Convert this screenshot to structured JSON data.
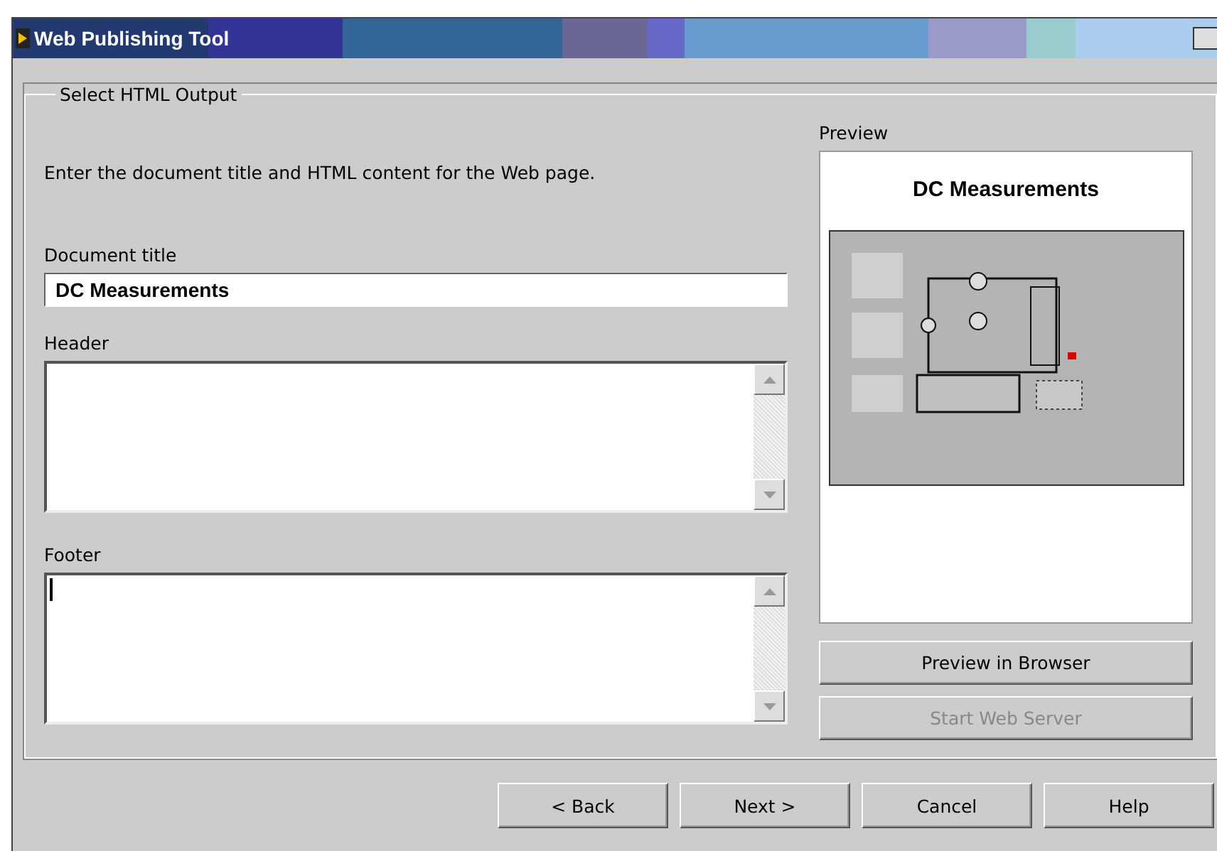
{
  "window": {
    "title": "Web Publishing Tool"
  },
  "group": {
    "label": "Select HTML Output",
    "instructions": "Enter the document title and HTML content for the Web page."
  },
  "fields": [
    {
      "kind": "single",
      "label": "Document title",
      "value": "DC Measurements"
    },
    {
      "kind": "multiline",
      "label": "Header",
      "focused": false
    },
    {
      "kind": "multiline",
      "label": "Footer",
      "focused": true
    }
  ],
  "preview": {
    "label": "Preview",
    "page_title": "DC Measurements"
  },
  "preview_buttons": [
    {
      "label": "Preview in Browser",
      "disabled": false
    },
    {
      "label": "Start Web Server",
      "disabled": true
    }
  ],
  "buttons": [
    {
      "label": "< Back",
      "disabled": false
    },
    {
      "label": "Next >",
      "disabled": false
    },
    {
      "label": "Cancel",
      "disabled": false
    },
    {
      "label": "Help",
      "disabled": false
    }
  ]
}
